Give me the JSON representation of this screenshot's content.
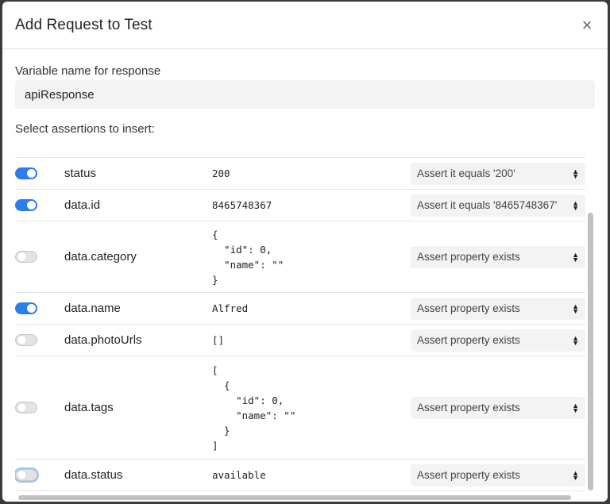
{
  "dialog": {
    "title": "Add Request to Test",
    "close_label": "×"
  },
  "variable": {
    "label": "Variable name for response",
    "value": "apiResponse"
  },
  "assertions_label": "Select assertions to insert:",
  "rows": [
    {
      "enabled": true,
      "path": "status",
      "value": "200",
      "assertion": "Assert it equals '200'"
    },
    {
      "enabled": true,
      "path": "data.id",
      "value": "8465748367",
      "assertion": "Assert it equals '8465748367'"
    },
    {
      "enabled": false,
      "path": "data.category",
      "value": "{\n  \"id\": 0,\n  \"name\": \"\"\n}",
      "assertion": "Assert property exists"
    },
    {
      "enabled": true,
      "path": "data.name",
      "value": "Alfred",
      "assertion": "Assert property exists"
    },
    {
      "enabled": false,
      "path": "data.photoUrls",
      "value": "[]",
      "assertion": "Assert property exists"
    },
    {
      "enabled": false,
      "path": "data.tags",
      "value": "[\n  {\n    \"id\": 0,\n    \"name\": \"\"\n  }\n]",
      "assertion": "Assert property exists"
    },
    {
      "enabled": false,
      "path": "data.status",
      "value": "available",
      "assertion": "Assert property exists"
    }
  ],
  "colors": {
    "toggle_on": "#2b7de9",
    "toggle_off": "#e3e3e3",
    "select_bg": "#f3f3f3"
  }
}
